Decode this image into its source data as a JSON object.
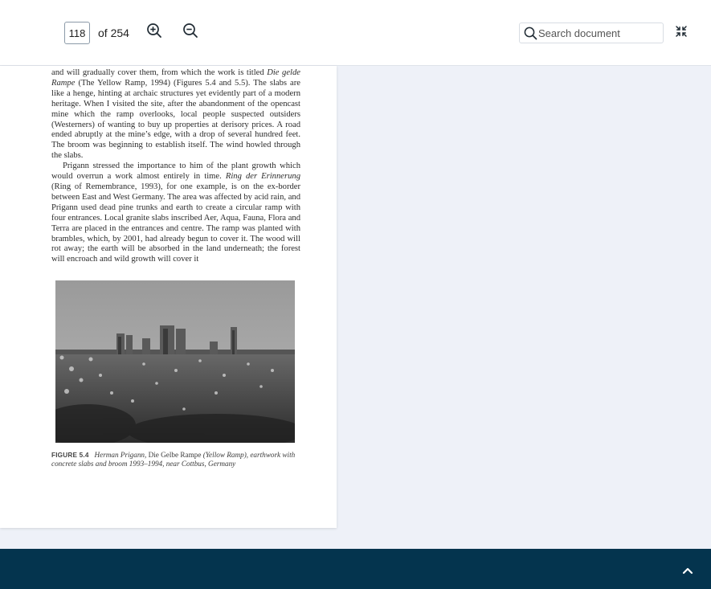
{
  "toolbar": {
    "page_current": "118",
    "page_total_label": "of 254",
    "search_placeholder": "Search document",
    "icons": {
      "zoom_in": "zoom-in-icon",
      "zoom_out": "zoom-out-icon",
      "search": "search-icon",
      "collapse": "collapse-icon"
    }
  },
  "document": {
    "paragraph_1": [
      "and will gradually cover them, from which the work is titled ",
      "Die gelde Rampe",
      " (The Yellow Ramp, 1994) (Figures 5.4 and 5.5). The slabs are like a henge, hinting at archaic structures yet evidently part of a modern heritage. When I visited the site, after the abandonment of the opencast mine which the ramp overlooks, local people suspected outsiders (Westerners) of wanting to buy up properties at derisory prices. A road ended abruptly at the mine’s edge, with a drop of several hundred feet. The broom was beginning to establish itself. The wind howled through the slabs."
    ],
    "paragraph_2": [
      "Prigann stressed the importance to him of the plant growth which would overrun a work almost entirely in time. ",
      "Ring der Erinnerung",
      " (Ring of Remembrance, 1993), for one example, is on the ex-border between East and West Germany. The area was affected by acid rain, and Prigann used dead pine trunks and earth to create a circular ramp with four entrances. Local granite slabs inscribed Aer, Aqua, Fauna, Flora and Terra are placed in the entrances and centre. The ramp was planted with brambles, which, by 2001, had already begun to cover it. The wood will rot away; the earth will be absorbed in the land underneath; the forest will encroach and wild growth will cover it"
    ],
    "figure": {
      "label": "FIGURE 5.4",
      "caption_italic_1": "Herman Prigann,",
      "caption_roman": " Die Gelbe Rampe ",
      "caption_italic_2": "(Yellow Ramp), earthwork with concrete slabs and broom 1993–1994, near Cottbus, Germany"
    }
  },
  "footer": {
    "icons": {
      "scroll_top": "chevron-up-icon"
    },
    "colors": {
      "background": "#04344e"
    }
  }
}
